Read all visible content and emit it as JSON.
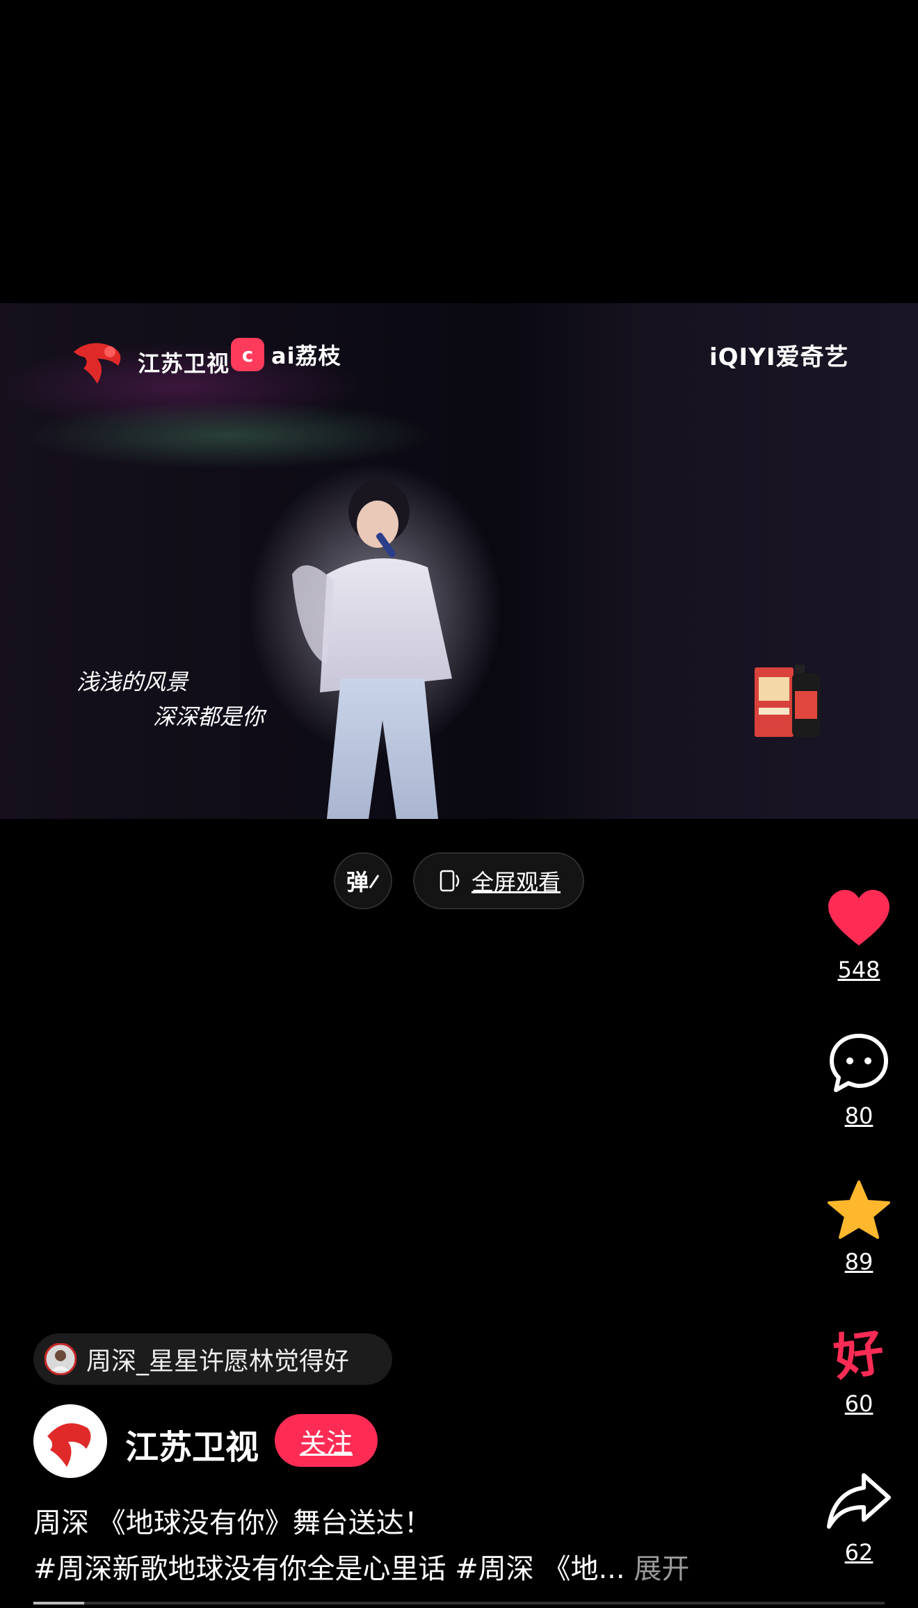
{
  "video": {
    "channel_logo": "江苏卫视",
    "partner_logo": "ai荔枝",
    "platform_logo": "iQIYI爱奇艺",
    "lyrics": {
      "line1": "浅浅的风景",
      "line2": "深深都是你"
    }
  },
  "controls": {
    "danmu_label": "弹",
    "fullscreen_label": "全屏观看"
  },
  "actions": {
    "like_count": "548",
    "comment_count": "80",
    "favorite_count": "89",
    "good_count": "60",
    "good_label": "好",
    "share_count": "62"
  },
  "post": {
    "tag_chip": "周深_星星许愿林觉得好",
    "account_name": "江苏卫视",
    "follow_label": "关注",
    "description_line1": "周深 《地球没有你》舞台送达！",
    "description_line2": "#周深新歌地球没有你全是心里话 #周深 《地...",
    "expand_label": "展开",
    "progress_fraction": 0.06
  },
  "colors": {
    "like": "#fe2c55",
    "favorite": "#ffb82e",
    "follow": "#fe2c55"
  }
}
